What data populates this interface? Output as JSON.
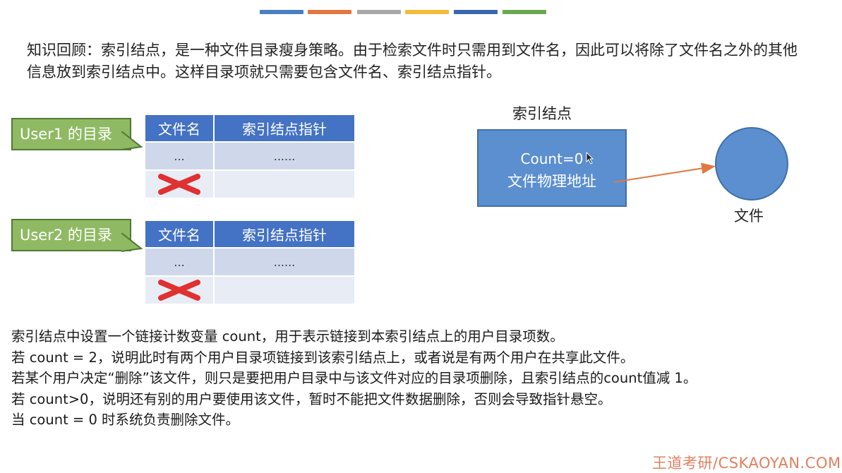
{
  "header_bars": [
    {
      "color": "#4a7fc0"
    },
    {
      "color": "#e07840"
    },
    {
      "color": "#a8a8a8"
    },
    {
      "color": "#f4bb3a"
    },
    {
      "color": "#3a66b0"
    },
    {
      "color": "#6aa84f"
    }
  ],
  "intro_text": "知识回顾：索引结点，是一种文件目录瘦身策略。由于检索文件时只需用到文件名，因此可以将除了文件名之外的其他信息放到索引结点中。这样目录项就只需要包含文件名、索引结点指针。",
  "user1": {
    "callout": "User1 的目录",
    "table": {
      "col1": "文件名",
      "col2": "索引结点指针",
      "row1_c1": "...",
      "row1_c2": "......"
    }
  },
  "user2": {
    "callout": "User2 的目录",
    "table": {
      "col1": "文件名",
      "col2": "索引结点指针",
      "row1_c1": "...",
      "row1_c2": "......"
    }
  },
  "inode": {
    "title": "索引结点",
    "count": "Count=0",
    "address": "文件物理地址"
  },
  "file": {
    "label": "文件"
  },
  "explanation": [
    "索引结点中设置一个链接计数变量 count，用于表示链接到本索引结点上的用户目录项数。",
    "若 count = 2，说明此时有两个用户目录项链接到该索引结点上，或者说是有两个用户在共享此文件。",
    "若某个用户决定“删除”该文件，则只是要把用户目录中与该文件对应的目录项删除，且索引结点的count值减 1。",
    "若 count>0，说明还有别的用户要使用该文件，暂时不能把文件数据删除，否则会导致指针悬空。",
    "当 count = 0 时系统负责删除文件。"
  ],
  "watermark": "王道考研/CSKAOYAN.COM",
  "colors": {
    "table_header": "#4472c4",
    "table_cell": "#cfd8ea",
    "callout_fill": "#8fba63",
    "inode_fill": "#5b8fd0",
    "arrow": "#e07840",
    "delete_mark": "#e03030"
  }
}
